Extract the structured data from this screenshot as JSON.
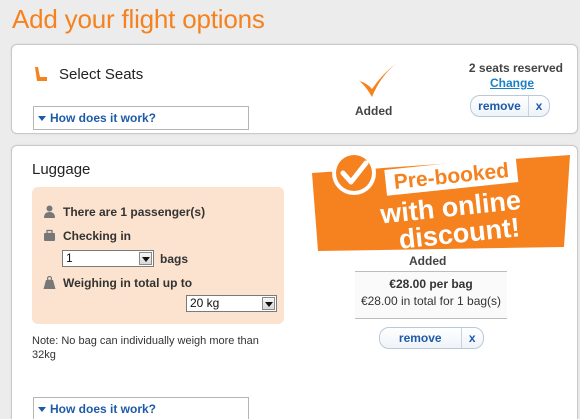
{
  "page": {
    "title": "Add your flight options"
  },
  "seats": {
    "title": "Select Seats",
    "how_link": "How does it work?",
    "status": "Added",
    "reserved": "2 seats reserved",
    "change": "Change",
    "remove": "remove",
    "close": "x"
  },
  "luggage": {
    "title": "Luggage",
    "passengers": "There are 1 passenger(s)",
    "checking_in": "Checking in",
    "bags_value": "1",
    "bags_label": "bags",
    "weighing": "Weighing in total up to",
    "weight_value": "20 kg",
    "note": "Note: No bag can individually weigh more than 32kg",
    "how_link": "How does it work?",
    "banner": {
      "line1": "Pre-booked",
      "line2": "with online",
      "line3": "discount!"
    },
    "status": "Added",
    "price_per_bag": "€28.00 per bag",
    "price_total": "€28.00 in total for 1 bag(s)",
    "remove": "remove",
    "close": "x"
  },
  "colors": {
    "accent": "#f5821f",
    "link": "#1d5ba8",
    "peach": "#fbe3cf"
  },
  "icons": [
    "seat-icon",
    "checkmark-icon",
    "person-icon",
    "suitcase-icon",
    "weight-icon",
    "dropdown-arrow-icon"
  ]
}
